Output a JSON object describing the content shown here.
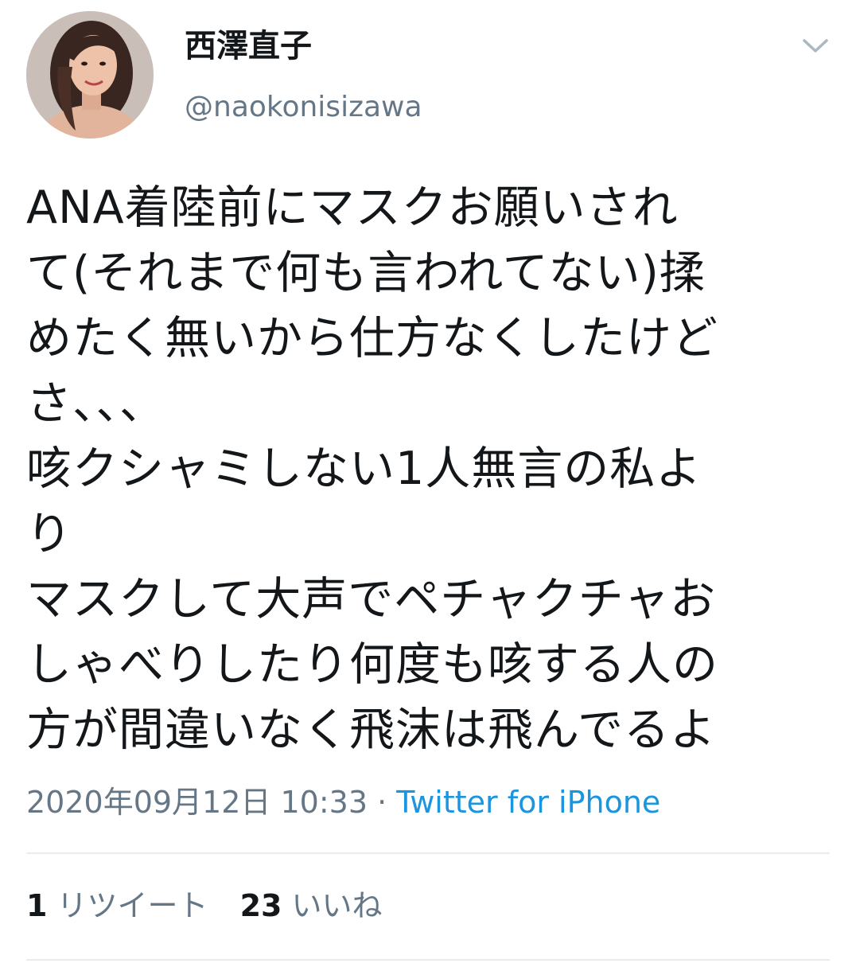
{
  "tweet": {
    "author": {
      "display_name": "西澤直子",
      "handle": "@naokonisizawa"
    },
    "text_lines": [
      "ANA着陸前にマスクお願いされ",
      "て(それまで何も言われてない)揉",
      "めたく無いから仕方なくしたけど",
      "さ、、、",
      "咳クシャミしない1人無言の私よ",
      "り",
      "マスクして大声でペチャクチャお",
      "しゃべりしたり何度も咳する人の",
      "方が間違いなく飛沫は飛んでるよ"
    ],
    "timestamp": "2020年09月12日 10:33",
    "separator": " · ",
    "source": "Twitter for iPhone",
    "stats": {
      "retweets_count": "1",
      "retweets_label": "リツイート",
      "likes_count": "23",
      "likes_label": "いいね"
    }
  },
  "icons": {
    "menu": "chevron-down-icon"
  },
  "colors": {
    "text_primary": "#14171a",
    "text_secondary": "#657786",
    "link": "#1b95e0",
    "divider": "#e6ecf0"
  }
}
